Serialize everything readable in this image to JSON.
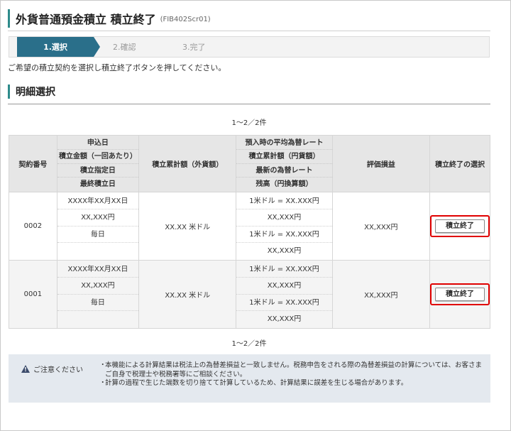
{
  "header": {
    "title": "外貨普通預金積立 積立終了",
    "screen_code": "(FIB402Scr01)"
  },
  "steps": [
    {
      "label": "1.選択",
      "active": true
    },
    {
      "label": "2.確認",
      "active": false
    },
    {
      "label": "3.完了",
      "active": false
    }
  ],
  "instruction": "ご希望の積立契約を選択し積立終了ボタンを押してください。",
  "section_title": "明細選択",
  "pagination": {
    "top": "1～2／2件",
    "bottom": "1～2／2件"
  },
  "table": {
    "headers": {
      "contract_no": "契約番号",
      "application": [
        "申込日",
        "積立金額（一回あたり）",
        "積立指定日",
        "最終積立日"
      ],
      "accumulated_fx": "積立累計額（外貨額）",
      "rates": [
        "預入時の平均為替レート",
        "積立累計額（円貨額）",
        "最新の為替レート",
        "残高（円換算額）"
      ],
      "valuation": "評価損益",
      "select": "積立終了の選択"
    },
    "rows": [
      {
        "contract_no": "0002",
        "application": [
          "XXXX年XX月XX日",
          "XX,XXX円",
          "毎日",
          ""
        ],
        "accumulated_fx": "XX.XX 米ドル",
        "rates": [
          "1米ドル = XX.XXX円",
          "XX,XXX円",
          "1米ドル = XX.XXX円",
          "XX,XXX円"
        ],
        "valuation": "XX,XXX円",
        "button": "積立終了"
      },
      {
        "contract_no": "0001",
        "application": [
          "XXXX年XX月XX日",
          "XX,XXX円",
          "毎日",
          ""
        ],
        "accumulated_fx": "XX.XX 米ドル",
        "rates": [
          "1米ドル = XX.XXX円",
          "XX,XXX円",
          "1米ドル = XX.XXX円",
          "XX,XXX円"
        ],
        "valuation": "XX,XXX円",
        "button": "積立終了"
      }
    ]
  },
  "notice": {
    "heading": "ご注意ください",
    "icon": "warning-icon",
    "items": [
      "本機能による計算結果は税法上の為替差損益と一致しません。税務申告をされる際の為替差損益の計算については、お客さまご自身で税理士や税務署等にご相談ください。",
      "計算の過程で生じた端数を切り捨てて計算しているため、計算結果に誤差を生じる場合があります。"
    ]
  },
  "colors": {
    "accent": "#2e8b8b",
    "step_active": "#2a6f8a",
    "highlight": "#e00000",
    "notice_bg": "#e4e9ef"
  }
}
